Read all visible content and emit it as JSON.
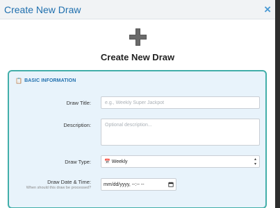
{
  "dialog": {
    "title": "Create New Draw",
    "close_glyph": "×"
  },
  "hero": {
    "icon": "plus-icon",
    "title": "Create New Draw"
  },
  "section": {
    "icon": "clipboard-icon",
    "title": "BASIC INFORMATION"
  },
  "form": {
    "draw_title": {
      "label": "Draw Title:",
      "placeholder": "e.g., Weekly Super Jackpot",
      "value": ""
    },
    "description": {
      "label": "Description:",
      "placeholder": "Optional description...",
      "value": ""
    },
    "draw_type": {
      "label": "Draw Type:",
      "icon": "calendar-icon",
      "value": "Weekly"
    },
    "draw_datetime": {
      "label": "Draw Date & Time:",
      "hint": "When should this draw be processed?",
      "value": "mm/dd/yyyy, --:-- --",
      "icon": "calendar-icon"
    }
  },
  "colors": {
    "accent": "#1f6fae",
    "card_border": "#41aea9",
    "card_bg": "#e8f3fb"
  }
}
